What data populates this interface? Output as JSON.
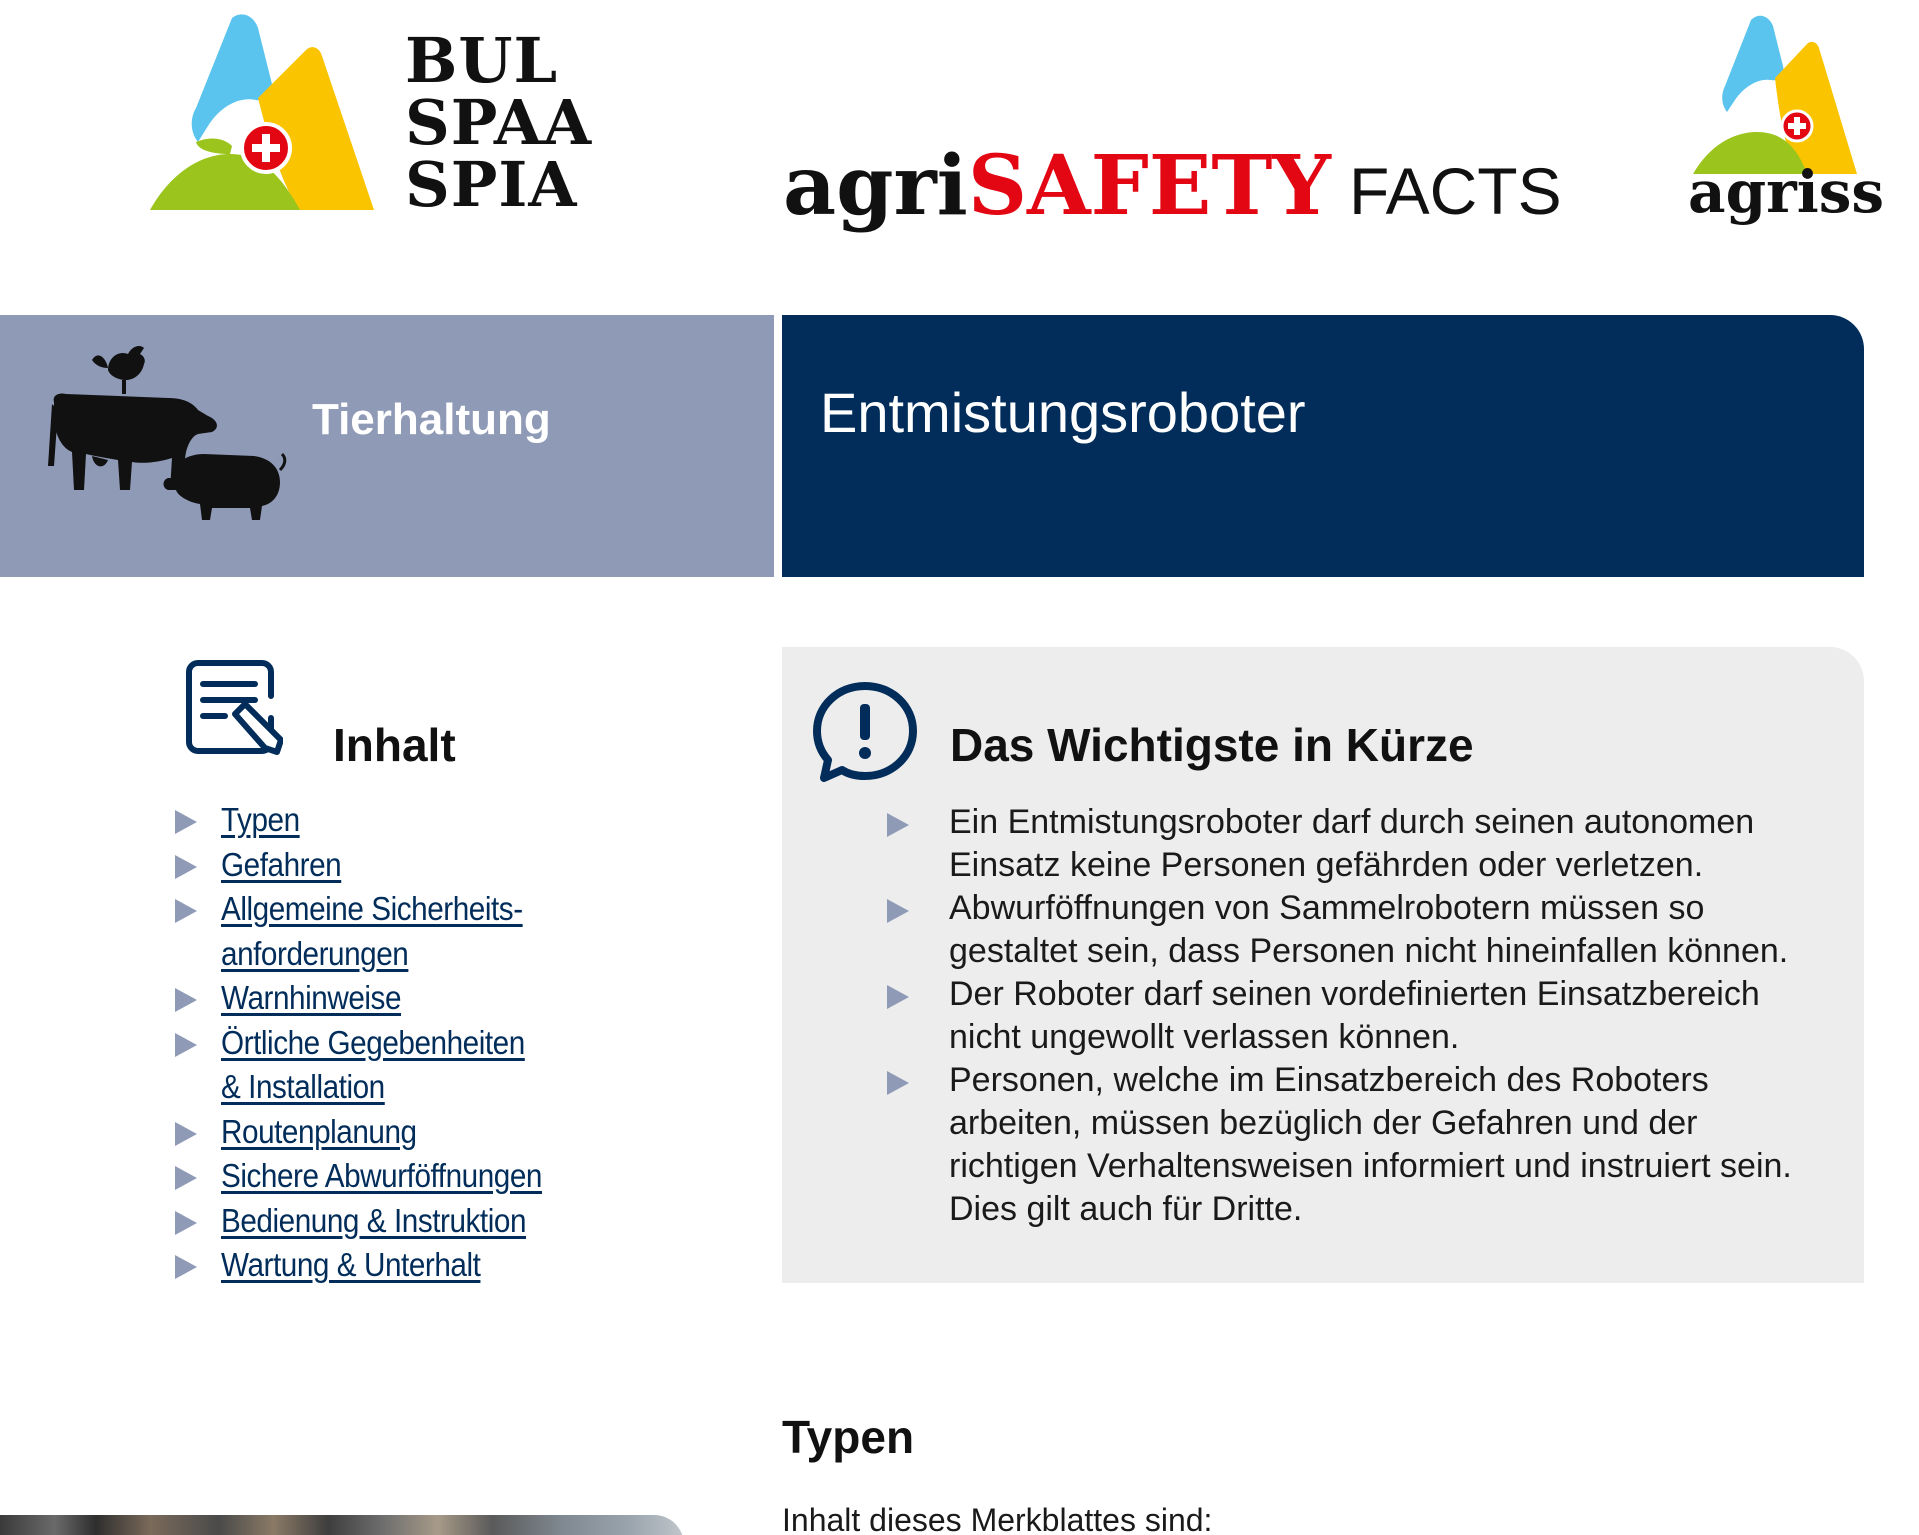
{
  "header": {
    "bul_lines": [
      "BUL",
      "SPAA",
      "SPIA"
    ],
    "agri_text": "agri",
    "safety_text": "SAFETY",
    "facts_text": "FACTS",
    "agriss_text": "agriss"
  },
  "banner": {
    "category": "Tierhaltung",
    "title": "Entmistungsroboter"
  },
  "colors": {
    "navy": "#022d5a",
    "category_bg": "#8f9ab6",
    "safety_red": "#e30613",
    "box_bg": "#ededed"
  },
  "toc": {
    "heading": "Inhalt",
    "items": [
      {
        "l1": "Typen",
        "l2": ""
      },
      {
        "l1": "Gefahren",
        "l2": ""
      },
      {
        "l1": "Allgemeine Sicherheits-",
        "l2": "anforderungen"
      },
      {
        "l1": "Warnhinweise",
        "l2": ""
      },
      {
        "l1": "Örtliche Gegebenheiten",
        "l2": "& Installation"
      },
      {
        "l1": "Routenplanung",
        "l2": ""
      },
      {
        "l1": "Sichere Abwurföffnungen",
        "l2": ""
      },
      {
        "l1": "Bedienung & Instruktion",
        "l2": ""
      },
      {
        "l1": "Wartung & Unterhalt",
        "l2": ""
      }
    ]
  },
  "summary": {
    "heading": "Das Wichtigste in Kürze",
    "items": [
      [
        "Ein Entmistungsroboter darf durch seinen autonomen",
        "Einsatz keine Personen gefährden oder verletzen."
      ],
      [
        "Abwurföffnungen von Sammelrobotern müssen so",
        "gestaltet sein, dass Personen nicht hineinfallen können."
      ],
      [
        "Der Roboter darf seinen vordefinierten Einsatzbereich",
        "nicht ungewollt verlassen können."
      ],
      [
        "Personen, welche im Einsatzbereich des Roboters",
        "arbeiten, müssen bezüglich der Gefahren und der",
        "richtigen Verhaltensweisen informiert und instruiert sein.",
        "Dies gilt auch für Dritte."
      ]
    ]
  },
  "typen": {
    "heading": "Typen",
    "intro": "Inhalt dieses Merkblattes sind:"
  },
  "icons": [
    "bul-logo-icon",
    "agriss-logo-icon",
    "animals-icon",
    "document-edit-icon",
    "alert-speech-icon",
    "swiss-cross-icon"
  ]
}
